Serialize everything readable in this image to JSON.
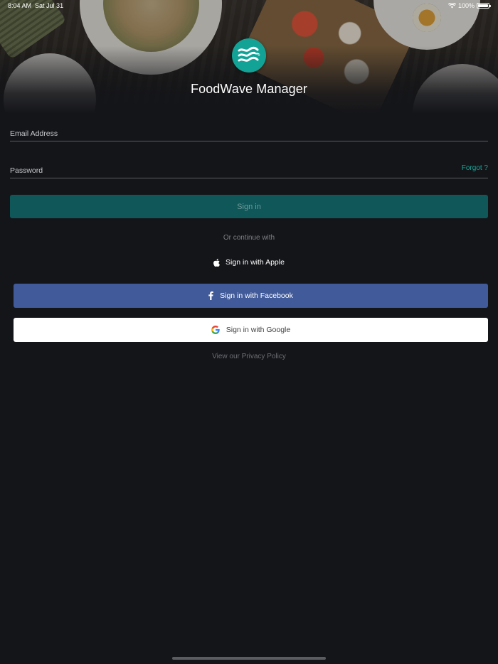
{
  "status_bar": {
    "time": "8:04 AM",
    "date": "Sat Jul 31",
    "battery": "100%",
    "icons": [
      "wifi-icon",
      "battery-icon"
    ]
  },
  "app": {
    "title": "FoodWave Manager",
    "logo_icon": "wave-fork-logo-icon",
    "accent_color": "#13a396"
  },
  "form": {
    "email_placeholder": "Email Address",
    "password_placeholder": "Password",
    "forgot_label": "Forgot ?",
    "signin_label": "Sign in"
  },
  "social": {
    "divider_text": "Or continue with",
    "apple_label": "Sign in with Apple",
    "facebook_label": "Sign in with Facebook",
    "google_label": "Sign in with Google",
    "facebook_color": "#415a99"
  },
  "footer": {
    "privacy_label": "View our Privacy Policy"
  }
}
